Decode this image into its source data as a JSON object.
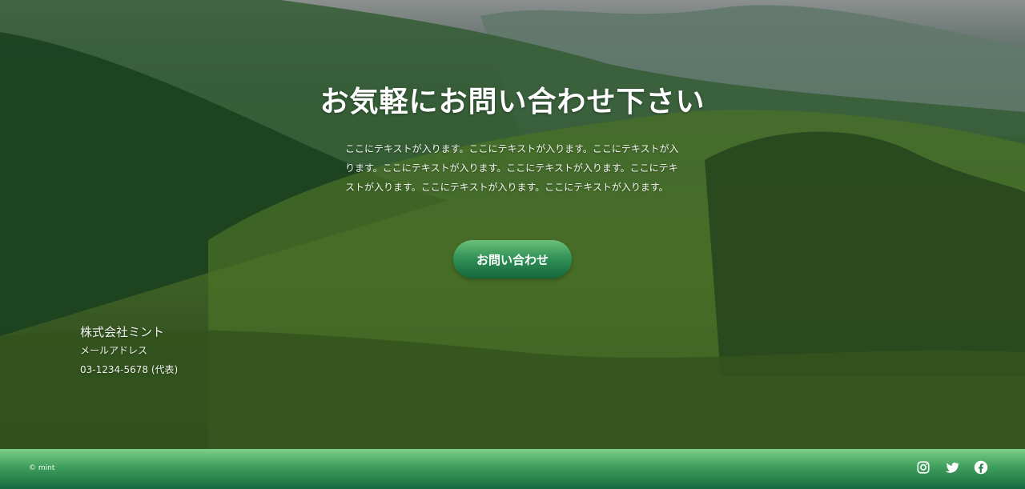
{
  "hero": {
    "title": "お気軽にお問い合わせ下さい",
    "lead": "ここにテキストが入ります。ここにテキストが入ります。ここにテキストが入ります。ここにテキストが入ります。ここにテキストが入ります。ここにテキストが入ります。ここにテキストが入ります。ここにテキストが入ります。",
    "cta_label": "お問い合わせ"
  },
  "company": {
    "name": "株式会社ミント",
    "email_label": "メールアドレス",
    "phone": "03-1234-5678 (代表)"
  },
  "footer": {
    "copyright": "© mint",
    "social_icons": [
      "instagram-icon",
      "twitter-icon",
      "facebook-icon"
    ]
  },
  "colors": {
    "cta_top": "#6bc07a",
    "cta_bottom": "#17663c",
    "footer_top": "#7bcf88",
    "footer_bottom": "#166a3f"
  }
}
